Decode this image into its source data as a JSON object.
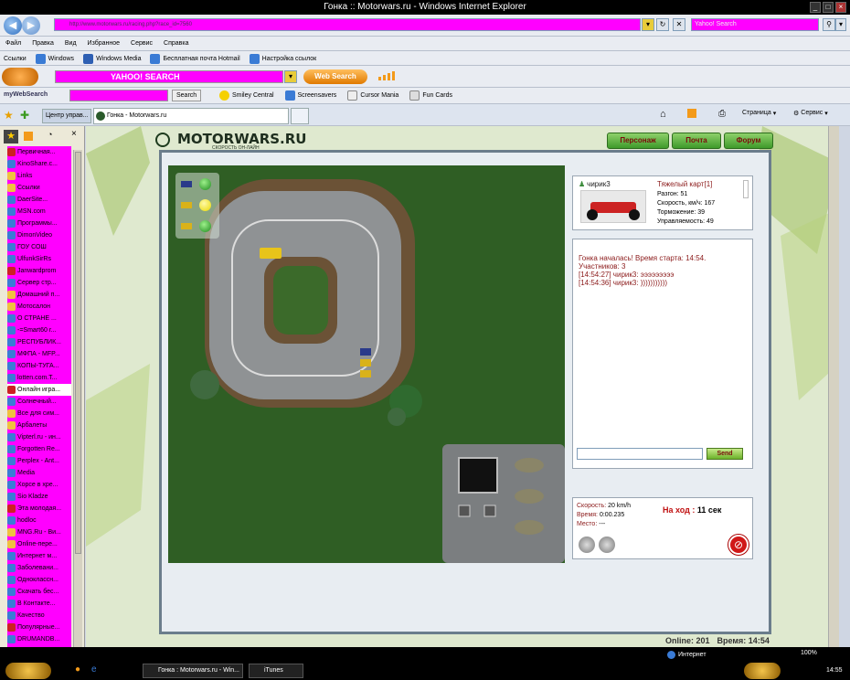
{
  "window": {
    "title": "Гонка :: Motorwars.ru - Windows Internet Explorer"
  },
  "address_bar": {
    "url": "http://www.motorwars.ru/racing.php?race_id=7560"
  },
  "search_box": {
    "placeholder": "Yahoo! Search"
  },
  "links_bar": {
    "label": "Ссылки",
    "items": [
      "Windows",
      "Windows Media",
      "Бесплатная почта Hotmail",
      "Настройка ссылок"
    ]
  },
  "menu_bar": {
    "items": [
      "Файл",
      "Правка",
      "Вид",
      "Избранное",
      "Сервис",
      "Справка"
    ]
  },
  "yahoo_toolbar": {
    "search_placeholder": "YAHOO! SEARCH",
    "web_search_label": "Web Search",
    "powered_by": "powered by"
  },
  "mywebsearch_toolbar": {
    "brand": "myWebSearch",
    "search_label": "Search",
    "items": [
      "Smiley Central",
      "Screensavers",
      "Cursor Mania",
      "Fun Cards"
    ]
  },
  "tabs": {
    "items": [
      "Центр управ...",
      "Гонка - Motorwars.ru"
    ]
  },
  "command_bar": {
    "page_label": "Страница",
    "tools_label": "Сервис"
  },
  "favorites": [
    "Первичная...",
    "KinoShare.c...",
    "Links",
    "Ссылки",
    "DaerSite...",
    "MSN.com",
    "Программы...",
    "DimonVideo",
    "ГОУ СОШ",
    "UlfunkSirRs",
    "Janwardprom",
    "Сервер стр...",
    "Домашний п...",
    "Мотосалон",
    "О СТРАНЕ ...",
    "-=Smart60 r...",
    "РЕСПУБЛИК...",
    "МФПА - MFP...",
    "КОПЫ-ТУГА...",
    "lotten.com.T...",
    "Онлайн игра...",
    "Солнечный...",
    "Все для сим...",
    "Арбалеты",
    "Vipterl.ru - ин...",
    "Forgotten Re...",
    "Perplex - Ant...",
    "Media",
    "Хорсе в хре...",
    "Sio Kladze",
    "Эта молодая...",
    "hodloc",
    "MNG.Ru - Ви...",
    "Online-пере...",
    "Интернет м...",
    "Заболевани...",
    "Одноклассн...",
    "Скачать бес...",
    "В Контакте...",
    "Качество",
    "Популярные...",
    "DRUMANDB...",
    "Ваб-хаус М..."
  ],
  "site": {
    "logo": "MOTORWARS.RU",
    "tagline": "СКОРОСТЬ ОН-ЛАЙН",
    "nav": [
      "Персонаж",
      "Почта",
      "Форум"
    ]
  },
  "player": {
    "name": "чирик3",
    "kart": "Тяжелый карт[1]",
    "stats": [
      "Разгон: 51",
      "Скорость, км/ч: 167",
      "Торможение: 39",
      "Управляемость: 49"
    ]
  },
  "chat": {
    "lines": [
      "Гонка началась! Время старта: 14:54.",
      "Участников: 3",
      "[14:54:27] чирик3: эээээээээ",
      "[14:54:36] чирик3: )))))))))))"
    ],
    "send_label": "Send"
  },
  "race_info": {
    "speed_label": "Скорость:",
    "speed_value": "20 km/h",
    "time_label": "Время:",
    "time_value": "0:00.235",
    "place_label": "Место:",
    "place_value": "---",
    "turn_label": "На ход :",
    "turn_value": "11 сек"
  },
  "footer": {
    "online": "Online: 201",
    "time": "Время: 14:54"
  },
  "status_bar": {
    "zone": "Интернет",
    "zoom": "100%"
  },
  "taskbar": {
    "items": [
      "Гонка : Motorwars.ru - Win...",
      "iTunes"
    ],
    "clock": "14:55"
  },
  "colors": {
    "magenta": "#ff00ff",
    "accent_green": "#3f9a2a",
    "chat_red": "#8b1a1a"
  }
}
